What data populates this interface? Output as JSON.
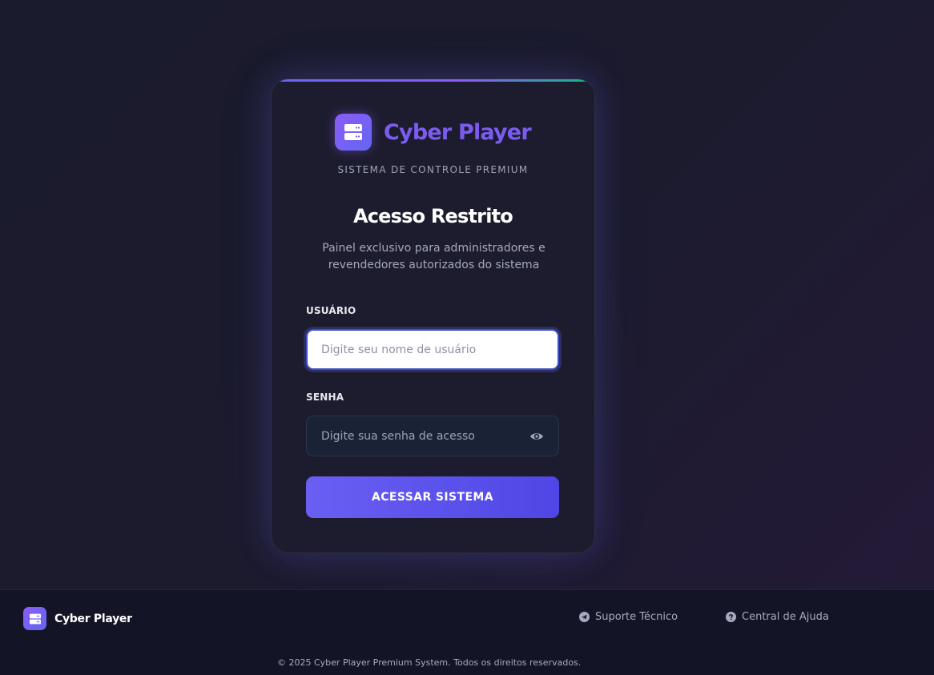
{
  "colors": {
    "accent": "#6366f1",
    "brand_purple": "#8b5cf6",
    "top_line_end": "#10b981",
    "card_bg": "#1c1c2e",
    "footer_bg": "#141427"
  },
  "login_card": {
    "brand_icon": "server-icon",
    "brand_name": "Cyber Player",
    "tagline": "SISTEMA DE CONTROLE PREMIUM",
    "heading": "Acesso Restrito",
    "subtitle": "Painel exclusivo para administradores e revendedores autorizados do sistema",
    "username": {
      "label": "USUÁRIO",
      "value": "",
      "placeholder": "Digite seu nome de usuário"
    },
    "password": {
      "label": "SENHA",
      "value": "",
      "placeholder": "Digite sua senha de acesso",
      "toggle_icon": "eye-icon"
    },
    "submit_label": "ACESSAR SISTEMA"
  },
  "footer": {
    "brand_icon": "server-icon",
    "brand_name": "Cyber Player",
    "links": [
      {
        "label": "Suporte Técnico",
        "icon": "telegram-icon"
      },
      {
        "label": "Central de Ajuda",
        "icon": "question-circle-icon"
      }
    ],
    "copyright": "© 2025 Cyber Player Premium System. Todos os direitos reservados."
  }
}
